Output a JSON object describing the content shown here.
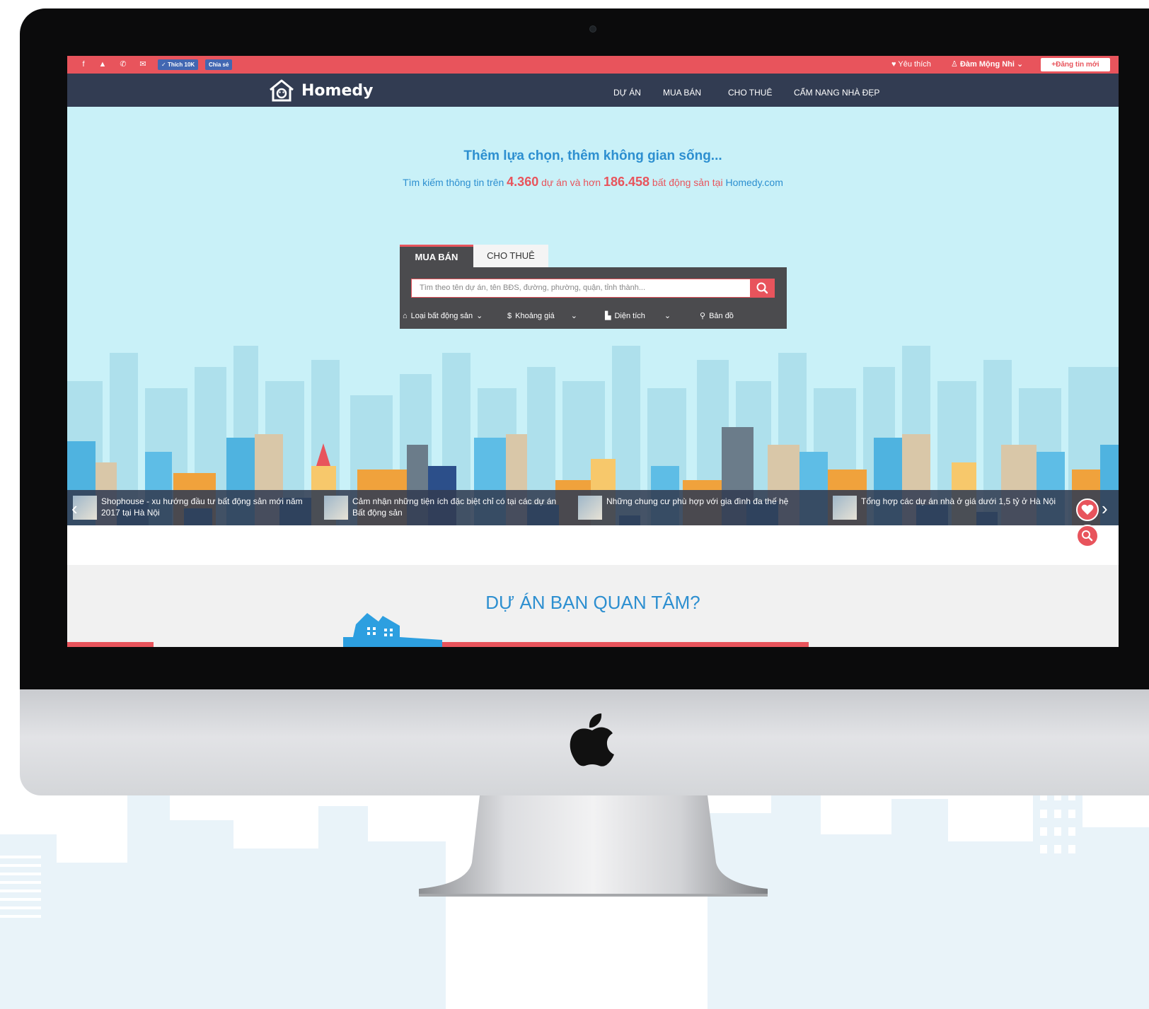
{
  "topbar": {
    "social_icons": [
      "facebook-icon",
      "youtube-icon",
      "phone-icon",
      "mail-icon"
    ],
    "like_label": "Thích 10K",
    "share_label": "Chia sẻ",
    "favorite_label": "Yêu thích",
    "user_name": "Đàm Mộng Nhi",
    "post_label": "Đăng tin mới"
  },
  "nav": {
    "brand": "Homedy",
    "items": [
      "DỰ ÁN",
      "MUA BÁN",
      "CHO THUÊ",
      "CẨM NANG NHÀ ĐẸP"
    ]
  },
  "hero": {
    "title": "Thêm lựa chọn, thêm không gian sống...",
    "sub_prefix": "Tìm kiếm thông tin trên",
    "projects_count": "4.360",
    "sub_mid": "dự án và hơn",
    "properties_count": "186.458",
    "sub_suffix": "bất động sản tại",
    "site": "Homedy.com"
  },
  "search": {
    "tabs": [
      "MUA BÁN",
      "CHO THUÊ"
    ],
    "placeholder": "Tìm theo tên dự án, tên BĐS, đường, phường, quận, tỉnh thành...",
    "filters": [
      "Loại bất động sản",
      "Khoảng giá",
      "Diện tích",
      "Bản đồ"
    ]
  },
  "news": [
    "Shophouse - xu hướng đầu tư bất động sản mới năm 2017 tại Hà Nội",
    "Cảm nhận những tiện ích đặc biệt chỉ có tại các dự án Bất động sản",
    "Những chung cư phù hợp với gia đình đa thế hệ",
    "Tổng hợp các dự án nhà ở giá dưới 1,5 tỷ ở Hà Nội"
  ],
  "section": {
    "title": "DỰ ÁN BẠN QUAN TÂM?"
  },
  "colors": {
    "accent": "#e8545c",
    "nav_bg": "#323c52",
    "hero_bg": "#c9f1f8",
    "brand_blue": "#2d8fd0"
  }
}
